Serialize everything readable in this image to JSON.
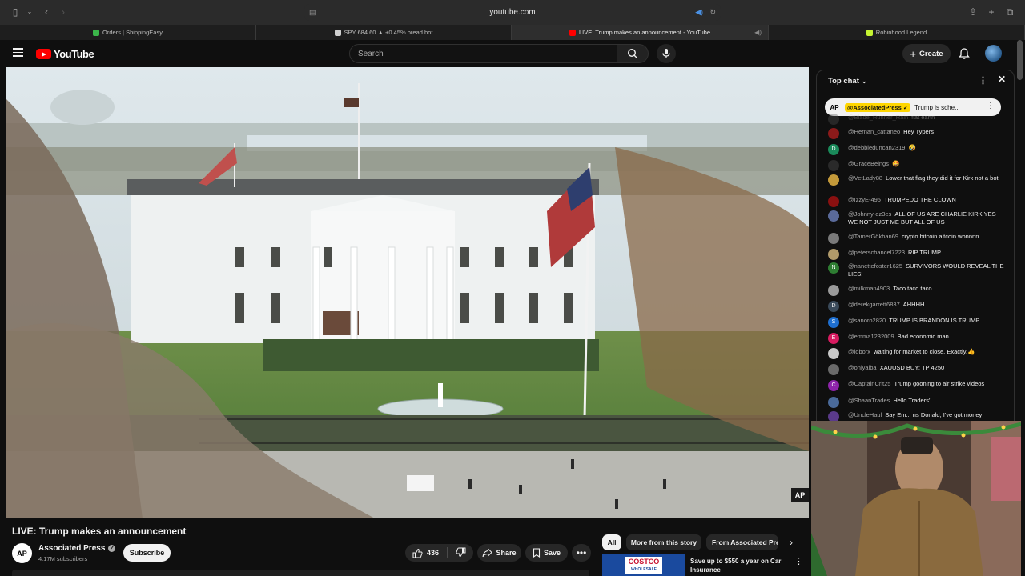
{
  "browser": {
    "url": "youtube.com",
    "tabs": [
      {
        "label": "Orders | ShippingEasy",
        "favicon_color": "#3bb54a"
      },
      {
        "label": "SPY 684.60 ▲ +0.45% bread bot",
        "favicon_color": "#d0d0d0"
      },
      {
        "label": "LIVE: Trump makes an announcement - YouTube",
        "favicon_color": "#ff0000"
      },
      {
        "label": "Robinhood Legend",
        "favicon_color": "#c6f432"
      }
    ]
  },
  "header": {
    "logo_text": "YouTube",
    "search_placeholder": "Search",
    "create_label": "Create"
  },
  "video": {
    "watermark": "AP",
    "title": "LIVE: Trump makes an announcement"
  },
  "channel": {
    "avatar_text": "AP",
    "name": "Associated Press",
    "subscribers": "4.17M subscribers",
    "subscribe_label": "Subscribe"
  },
  "actions": {
    "likes": "436",
    "share_label": "Share",
    "save_label": "Save"
  },
  "chips": {
    "items": [
      "All",
      "More from this story",
      "From Associated Press"
    ]
  },
  "ad": {
    "logo_line1": "COSTCO",
    "logo_line2": "WHOLESALE",
    "text": "Save up to $550 a year on Car Insurance"
  },
  "chat": {
    "mode_label": "Top chat",
    "pinned": {
      "avatar": "AP",
      "name": "@AssociatedPress ✓",
      "text": "Trump is sche..."
    },
    "partial_top": {
      "name": "@Blade_Runner_Rain",
      "text": "flat earth"
    },
    "messages": [
      {
        "name": "@Hernan_cattaneo",
        "text": "Hey Typers",
        "color": "#8b1a1a",
        "letter": ""
      },
      {
        "name": "@debbieduncan2319",
        "text": "🤣",
        "color": "#1a8a5a",
        "letter": "D"
      },
      {
        "name": "@GraceBeings",
        "text": "🤩",
        "color": "#2a2a2a",
        "letter": ""
      },
      {
        "name": "@VetLady88",
        "text": "Lower that flag they did it for Kirk not a bot",
        "color": "#c49a3a",
        "letter": ""
      },
      {
        "name": "@IzzyE-495",
        "text": "TRUMPEDO THE CLOWN",
        "color": "#8a1010",
        "letter": ""
      },
      {
        "name": "@Johnny-ez3es",
        "text": "ALL OF US ARE CHARLIE KIRK YES WE NOT JUST ME BUT ALL OF US",
        "color": "#5a6a9a",
        "letter": ""
      },
      {
        "name": "@TamerGökhan69",
        "text": "crypto bitcoin altcoin wonnnn",
        "color": "#7a7a7a",
        "letter": ""
      },
      {
        "name": "@peterschancel7223",
        "text": "RIP TRUMP",
        "color": "#b09a6a",
        "letter": ""
      },
      {
        "name": "@nanettefoster1625",
        "text": "SURVIVORS WOULD REVEAL THE LIES!",
        "color": "#2e7d32",
        "letter": "N"
      },
      {
        "name": "@milkman4903",
        "text": "Taco taco taco",
        "color": "#9a9a9a",
        "letter": ""
      },
      {
        "name": "@derekgarrett6837",
        "text": "AHHHH",
        "color": "#3a4a5a",
        "letter": "D"
      },
      {
        "name": "@sanoro2820",
        "text": "TRUMP IS BRANDON IS TRUMP",
        "color": "#1e6fd0",
        "letter": "S"
      },
      {
        "name": "@emma1232009",
        "text": "Bad economic man",
        "color": "#d81b60",
        "letter": "E"
      },
      {
        "name": "@loborx",
        "text": "waiting for market to close. Exactly.👍",
        "color": "#c8c8c8",
        "letter": ""
      },
      {
        "name": "@onlyalba",
        "text": "XAUUSD BUY: TP 4250",
        "color": "#6a6a6a",
        "letter": ""
      },
      {
        "name": "@CaptainCrit25",
        "text": "Trump gooning to air strike videos",
        "color": "#8e24aa",
        "letter": "C"
      },
      {
        "name": "@ShaanTrades",
        "text": "Hello Traders'",
        "color": "#4a6a9a",
        "letter": ""
      },
      {
        "name": "@UncleHaul",
        "text": "Say Em... ns Donald, I've got money",
        "color": "#5a3a8a",
        "letter": ""
      }
    ]
  }
}
